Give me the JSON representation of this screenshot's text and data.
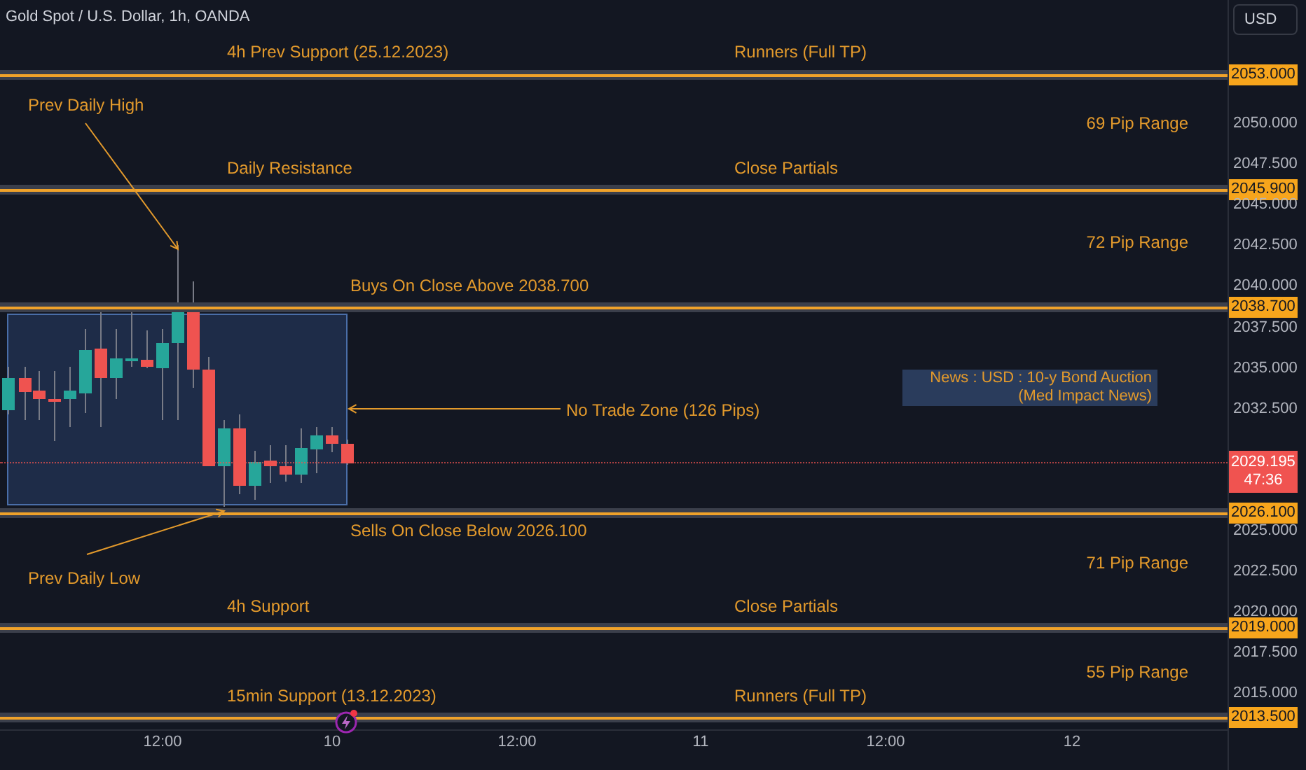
{
  "title": "Gold Spot / U.S. Dollar, 1h, OANDA",
  "currency_button": "USD",
  "levels": [
    {
      "price": "2053.000",
      "labels": [
        {
          "text": "4h Prev Support (25.12.2023)",
          "kind": "name"
        },
        {
          "text": "Runners (Full TP)",
          "kind": "target"
        }
      ]
    },
    {
      "price": "2045.900",
      "labels": [
        {
          "text": "Daily Resistance",
          "kind": "name"
        },
        {
          "text": "Close Partials",
          "kind": "target"
        }
      ]
    },
    {
      "price": "2038.700",
      "labels": [
        {
          "text": "Buys On Close Above 2038.700",
          "kind": "buy"
        }
      ]
    },
    {
      "price": "2026.100",
      "labels": [
        {
          "text": "Sells On Close Below 2026.100",
          "kind": "sell"
        }
      ]
    },
    {
      "price": "2019.000",
      "labels": [
        {
          "text": "4h Support",
          "kind": "name"
        },
        {
          "text": "Close Partials",
          "kind": "target"
        }
      ]
    },
    {
      "price": "2013.500",
      "labels": [
        {
          "text": "15min Support (13.12.2023)",
          "kind": "name"
        },
        {
          "text": "Runners (Full TP)",
          "kind": "target"
        }
      ]
    }
  ],
  "range_labels": [
    "69 Pip Range",
    "72 Pip Range",
    "71 Pip Range",
    "55 Pip Range"
  ],
  "annotations": [
    "Prev Daily High",
    "No Trade Zone (126 Pips)",
    "Prev Daily Low"
  ],
  "news": {
    "title": "News : USD : 10-y Bond Auction",
    "impact": "(Med Impact News)"
  },
  "current_price": {
    "price": "2029.195",
    "countdown": "47:36"
  },
  "price_axis": [
    "2050.000",
    "2047.500",
    "2045.000",
    "2042.500",
    "2040.000",
    "2037.500",
    "2035.000",
    "2032.500",
    "2025.000",
    "2022.500",
    "2020.000",
    "2017.500",
    "2015.000"
  ],
  "time_axis": [
    "12:00",
    "10",
    "12:00",
    "11",
    "12:00",
    "12"
  ]
}
